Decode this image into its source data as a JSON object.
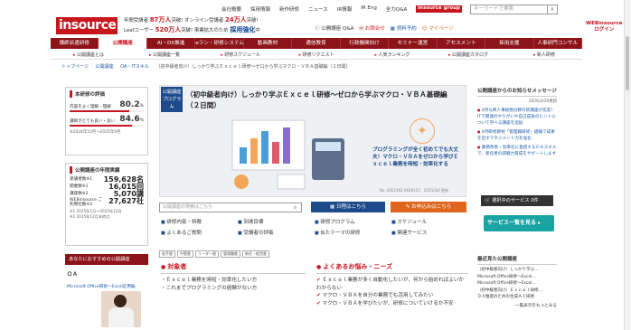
{
  "header": {
    "logo_text": "insource",
    "stats": {
      "line1_prefix": "年間受講者",
      "line1_value": "87万人",
      "line1_suffix": "突破!",
      "line2_prefix": "オンライン受講者",
      "line2_value": "24万人",
      "line2_suffix": "突破!",
      "line3_prefix": "Leafユーザー",
      "line3_value": "520万人",
      "line3_suffix": "突破!",
      "line4_prefix": "事業拡大のため",
      "line4_value": "採用強化",
      "line4_suffix": "中"
    },
    "top_links": [
      "会社概要",
      "採用情報",
      "新作研修",
      "ニュース",
      "IR情報",
      "IR Eng",
      "全力Q&A"
    ],
    "brand_tag": "insource group",
    "search_placeholder": "キーワードで検索",
    "util_links": {
      "guide": "公開講座 Q&A",
      "inquiry": "お問合せ",
      "reserve": "資料予約",
      "mypage": "マイページ"
    },
    "webinsource": "WEBinsource\nログイン"
  },
  "mainnav": [
    "講師派遣研修",
    "公開講座",
    "AI・DX推進",
    "eラン・研修システム",
    "動画教材",
    "通信教育",
    "行政機関向け",
    "セミナー運営",
    "アセスメント",
    "採用支援",
    "人事研門コンサル"
  ],
  "subnav": [
    "公開講座とは",
    "公開講座一覧",
    "研修スケジュール",
    "研修リクエスト",
    "人気ランキング",
    "公開講座カタログ",
    "新人研修"
  ],
  "breadcrumb": [
    "トップページ",
    "公開講座",
    "OA・ITスキル",
    "（初中級者向け）しっかり学ぶＥｘｃｅｌ研修～ゼロから学ぶマクロ・ＶＢＡ基礎編（２日間）"
  ],
  "eval": {
    "title": "本研修の評価",
    "row1_label": "内容をよく理解・理解",
    "row1_value": "80.2",
    "row1_unit": "%",
    "row2_label": "講師がとても良い・良い",
    "row2_value": "84.6",
    "row2_unit": "%",
    "period": "※2024年10月～2025年9月"
  },
  "annual": {
    "title": "公開講座の年間実績",
    "rows": [
      {
        "label": "受講者数※1",
        "value": "159,628名"
      },
      {
        "label": "開催数※1",
        "value": "16,015回"
      },
      {
        "label": "講座数※2",
        "value": "5,070講"
      },
      {
        "label": "WEBinsource ご利用社数※2",
        "value": "27,627社"
      }
    ],
    "note1": "※1 2025年1月～2025年12月",
    "note2": "※2 2025年12月末時点"
  },
  "recommend": {
    "title": "あなたにおすすめの公開講座",
    "sub": "ＯＡ",
    "item": "Microsoft Office研修～Excel応用編"
  },
  "hero": {
    "tag": "公開講座プログラム",
    "title": "（初中級者向け）しっかり学ぶＥｘｃｅｌ研修～ゼロから学ぶマクロ・ＶＢＡ基礎編（２日間）",
    "text": "プログラミングが全く初めてでも大丈夫！マクロ・ＶＢＡをゼロから学びＥｘｃｅｌ業務を時短・効率化する",
    "meta": "No. 0051802 6689153　2025/3/4 更新"
  },
  "course_search_placeholder": "公開講座の検索はこちら",
  "btn_schedule": "日程はこちら",
  "btn_apply": "お申込みはこちら",
  "links": [
    "研修内容・特徴",
    "到達目標",
    "研修プログラム",
    "スケジュール",
    "よくあるご質問",
    "受講者の評価",
    "似たテーマの研修",
    "関連サービス"
  ],
  "tags": [
    "若手層",
    "中堅層",
    "リーダー層",
    "管理職層",
    "新任・経営層"
  ],
  "target": {
    "heading": "対象者",
    "items": [
      "Ｅｘｃｅｌ業務を時短・効率化したい方",
      "これまでプログラミングの経験がない方"
    ]
  },
  "faq": {
    "heading": "よくあるお悩み・ニーズ",
    "items": [
      "Ｅｘｃｅｌ業務が多く自動化したいが、何から始めればよいかわからない",
      "マクロ・ＶＢＡを自分の業務でも活用してみたい",
      "マクロ・ＶＢＡを学びたいが、研修についていけるか不安"
    ]
  },
  "messages": {
    "title": "公開講座からのお知らせメッセージ",
    "date": "2026/3/16更新",
    "items": [
      "4月以降人事総務分野の新講座が充実！ITで関連のやりがいや自己成長のヒントについて学べる講座を追加",
      "4月研修教材「管理職研修」組織で成果を出すマネジメント力を強化",
      "業務改善・効率化に直結するＯＡスキルで、新任者の即戦力育成をサポートします"
    ]
  },
  "chip_dark": "選択中のサービス 0件",
  "chip_teal": "サービス一覧を見る",
  "recent": {
    "title": "最近見た公開講座",
    "items": [
      "（初中級者向け）しっかり学ぶ…",
      "Microsoft Office研修～Excel…",
      "Microsoft Office研修～Excel…",
      "（初中級者向け）Ｅｘｃｅｌ研修…",
      "ＤＸ推進のための生成ＡＩ研修"
    ],
    "more": "一覧表示をもっとみる"
  }
}
